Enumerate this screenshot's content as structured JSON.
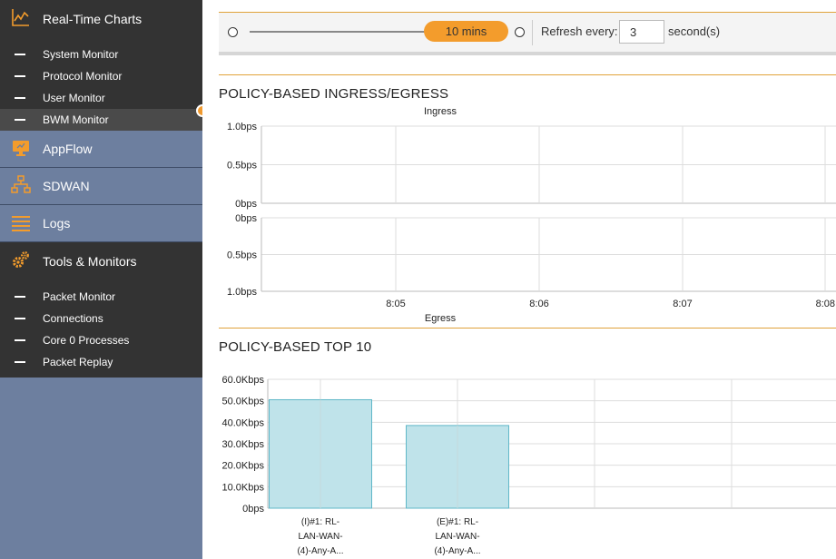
{
  "sidebar": {
    "realtime": {
      "label": "Real-Time Charts",
      "icon": "line-chart-icon"
    },
    "realtime_items": [
      {
        "label": "System Monitor"
      },
      {
        "label": "Protocol Monitor"
      },
      {
        "label": "User Monitor"
      },
      {
        "label": "BWM Monitor",
        "active": true
      }
    ],
    "appflow": {
      "label": "AppFlow",
      "icon": "monitor-icon"
    },
    "sdwan": {
      "label": "SDWAN",
      "icon": "network-icon"
    },
    "logs": {
      "label": "Logs",
      "icon": "list-icon"
    },
    "tools": {
      "label": "Tools & Monitors",
      "icon": "gears-icon"
    },
    "tools_items": [
      {
        "label": "Packet Monitor"
      },
      {
        "label": "Connections"
      },
      {
        "label": "Core 0 Processes"
      },
      {
        "label": "Packet Replay"
      }
    ]
  },
  "toolbar": {
    "slider_value": "10 mins",
    "refresh_label": "Refresh every:",
    "refresh_value": "3",
    "refresh_unit": "second(s)"
  },
  "ingress_egress": {
    "title": "POLICY-BASED INGRESS/EGRESS",
    "chart_data": [
      {
        "type": "line",
        "title": "Ingress",
        "ylabel": "",
        "y_ticks": [
          "1.0bps",
          "0.5bps",
          "0bps"
        ],
        "ylim": [
          0,
          1
        ],
        "x_ticks": [
          "8:05",
          "8:06",
          "8:07",
          "8:08"
        ],
        "series": []
      },
      {
        "type": "line",
        "title": "Egress",
        "ylabel": "",
        "y_ticks": [
          "0bps",
          "0.5bps",
          "1.0bps"
        ],
        "ylim": [
          0,
          1
        ],
        "x_ticks": [
          "8:05",
          "8:06",
          "8:07",
          "8:08"
        ],
        "series": []
      }
    ]
  },
  "top10": {
    "title": "POLICY-BASED TOP 10",
    "chart_data": {
      "type": "bar",
      "y_ticks": [
        "60.0Kbps",
        "50.0Kbps",
        "40.0Kbps",
        "30.0Kbps",
        "20.0Kbps",
        "10.0Kbps",
        "0bps"
      ],
      "ylim": [
        0,
        60
      ],
      "unit": "Kbps",
      "categories": [
        [
          "(I)#1: RL-",
          "LAN-WAN-",
          "(4)-Any-A..."
        ],
        [
          "(E)#1: RL-",
          "LAN-WAN-",
          "(4)-Any-A..."
        ]
      ],
      "values": [
        50.5,
        38.5
      ],
      "bar_color": "#bfe3ea",
      "bar_border": "#5fb7c8"
    }
  },
  "colors": {
    "accent": "#f39c2c",
    "sidebar_dark": "#333333",
    "sidebar_light": "#6d7f9f"
  }
}
